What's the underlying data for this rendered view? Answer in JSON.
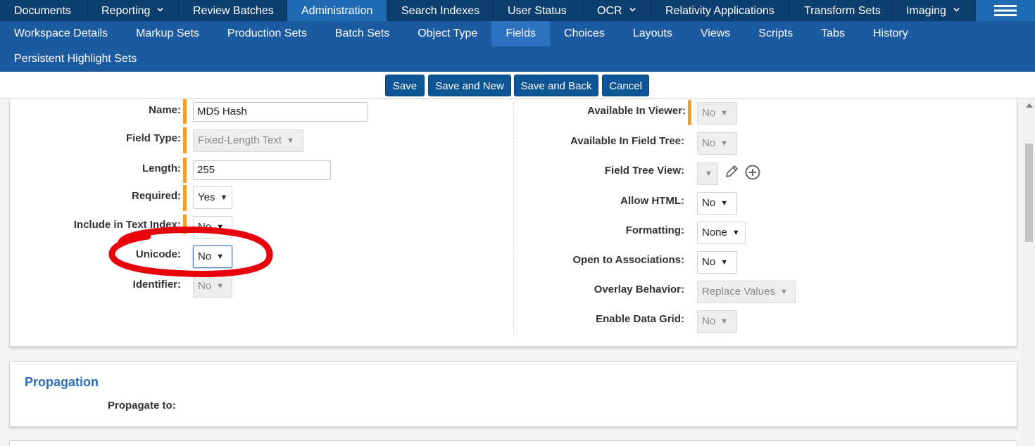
{
  "topnav": {
    "tabs": [
      {
        "label": "Documents"
      },
      {
        "label": "Reporting",
        "has_chevron": true
      },
      {
        "label": "Review Batches"
      },
      {
        "label": "Administration",
        "active": true
      },
      {
        "label": "Search Indexes"
      },
      {
        "label": "User Status"
      },
      {
        "label": "OCR",
        "has_chevron": true
      },
      {
        "label": "Relativity Applications"
      },
      {
        "label": "Transform Sets"
      },
      {
        "label": "Imaging",
        "has_chevron": true
      }
    ],
    "menu_icon": "hamburger-icon"
  },
  "subnav": {
    "row1": [
      {
        "label": "Workspace Details"
      },
      {
        "label": "Markup Sets"
      },
      {
        "label": "Production Sets"
      },
      {
        "label": "Batch Sets"
      },
      {
        "label": "Object Type"
      },
      {
        "label": "Fields",
        "active": true
      },
      {
        "label": "Choices"
      },
      {
        "label": "Layouts"
      },
      {
        "label": "Views"
      },
      {
        "label": "Scripts"
      },
      {
        "label": "Tabs"
      },
      {
        "label": "History"
      }
    ],
    "row2": [
      {
        "label": "Persistent Highlight Sets"
      }
    ]
  },
  "toolbar": {
    "save": "Save",
    "save_and_new": "Save and New",
    "save_and_back": "Save and Back",
    "cancel": "Cancel"
  },
  "form_left": {
    "name_label": "Name:",
    "name_value": "MD5 Hash",
    "field_type_label": "Field Type:",
    "field_type_value": "Fixed-Length Text",
    "length_label": "Length:",
    "length_value": "255",
    "required_label": "Required:",
    "required_value": "Yes",
    "text_index_label": "Include in Text Index:",
    "text_index_value": "No",
    "unicode_label": "Unicode:",
    "unicode_value": "No",
    "identifier_label": "Identifier:",
    "identifier_value": "No"
  },
  "form_right": {
    "viewer_label": "Available In Viewer:",
    "viewer_value": "No",
    "field_tree_label": "Available In Field Tree:",
    "field_tree_value": "No",
    "field_tree_view_label": "Field Tree View:",
    "field_tree_view_value": "",
    "allow_html_label": "Allow HTML:",
    "allow_html_value": "No",
    "formatting_label": "Formatting:",
    "formatting_value": "None",
    "open_assoc_label": "Open to Associations:",
    "open_assoc_value": "No",
    "overlay_label": "Overlay Behavior:",
    "overlay_value": "Replace Values",
    "data_grid_label": "Enable Data Grid:",
    "data_grid_value": "No"
  },
  "propagation": {
    "title": "Propagation",
    "propagate_label": "Propagate to:"
  },
  "colors": {
    "topnav_bg": "#0d3f6e",
    "topnav_active": "#1f6bb3",
    "subnav_bg": "#1c5aa0",
    "button_bg": "#0e5596",
    "required_marker": "#f0a030",
    "annotation": "#e8000b"
  }
}
